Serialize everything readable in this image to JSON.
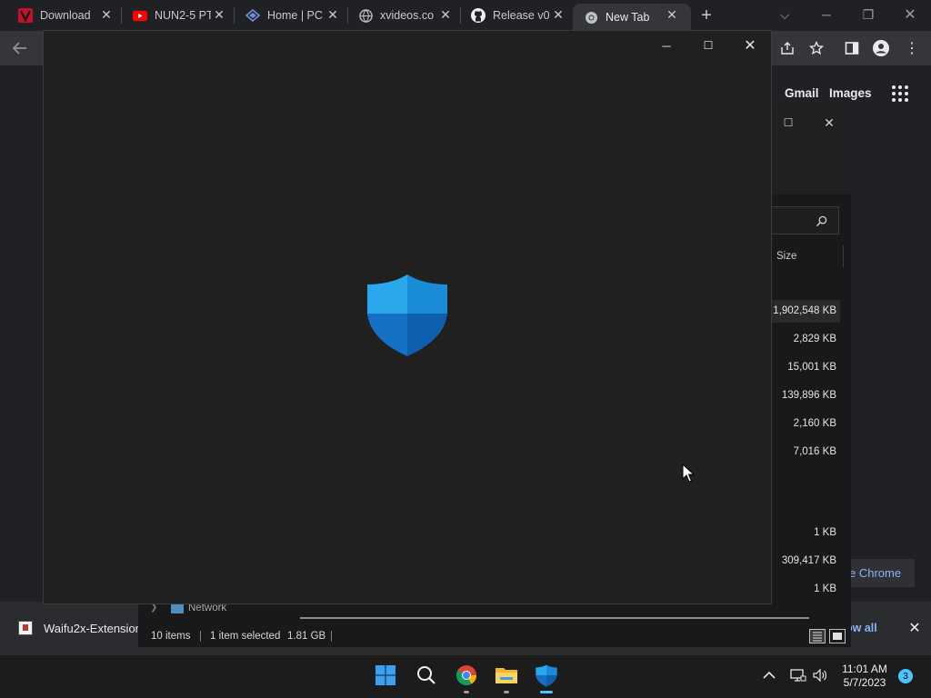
{
  "browser": {
    "tabs": [
      {
        "title": "Download",
        "favicon": "vivaldi-logo-icon"
      },
      {
        "title": "NUN2-5 PT",
        "favicon": "youtube-icon"
      },
      {
        "title": "Home | PC",
        "favicon": "pcgaming-icon"
      },
      {
        "title": "xvideos.co",
        "favicon": "globe-icon"
      },
      {
        "title": "Release v0",
        "favicon": "github-icon"
      },
      {
        "title": "New Tab",
        "favicon": "chrome-icon"
      }
    ],
    "new_tab_symbol": "+",
    "ntp_links": {
      "gmail": "Gmail",
      "images": "Images"
    },
    "customize_pill": "e Chrome"
  },
  "explorer": {
    "size_header": "Size",
    "sizes": [
      "1,902,548 KB",
      "2,829 KB",
      "15,001 KB",
      "139,896 KB",
      "2,160 KB",
      "7,016 KB",
      "1 KB",
      "309,417 KB",
      "1 KB"
    ],
    "nav_network": "Network",
    "status": {
      "items": "10 items",
      "selected": "1 item selected",
      "size": "1.81 GB"
    }
  },
  "download_bar": {
    "file": "Waifu2x-Extension",
    "show_all": "ow all"
  },
  "taskbar": {
    "time": "11:01 AM",
    "date": "5/7/2023",
    "notifications": "3"
  },
  "colors": {
    "accent": "#4cc2ff",
    "link": "#8ab4f8",
    "shield_light": "#2aa8ec",
    "shield_dark": "#0f5fb0"
  }
}
